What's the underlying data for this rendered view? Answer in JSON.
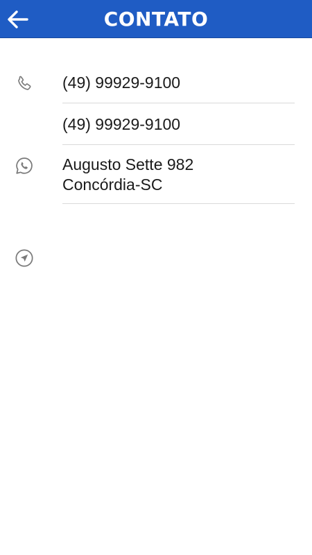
{
  "header": {
    "title": "CONTATO",
    "back_icon": "arrow-left-icon"
  },
  "colors": {
    "header_bg": "#1f5cc4",
    "text": "#1a1a1a",
    "icon": "#7a7a7a",
    "divider": "#d9d9d9"
  },
  "contacts": [
    {
      "icon": "phone-icon",
      "lines": [
        "(49) 99929-9100"
      ]
    },
    {
      "icon": "whatsapp-icon",
      "lines": [
        "(49) 99929-9100"
      ]
    },
    {
      "icon": "location-arrow-icon",
      "lines": [
        "Augusto Sette 982",
        "Concórdia-SC"
      ]
    }
  ]
}
